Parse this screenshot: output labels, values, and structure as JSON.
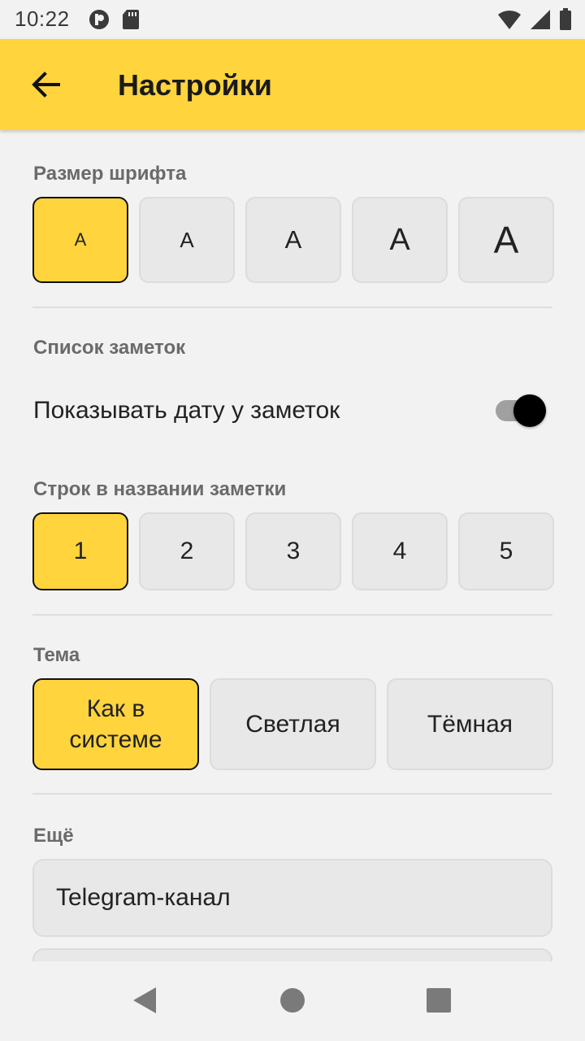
{
  "status_bar": {
    "time": "10:22",
    "left_icons": [
      "app-notification-icon",
      "sd-card-icon"
    ],
    "right_icons": [
      "wifi-icon",
      "cellular-icon",
      "battery-icon"
    ]
  },
  "app_bar": {
    "title": "Настройки",
    "background": "#ffd43d"
  },
  "font_size": {
    "label": "Размер шрифта",
    "options": [
      "A",
      "A",
      "A",
      "A",
      "A"
    ],
    "selected_index": 0
  },
  "notes_list": {
    "label": "Список заметок",
    "show_date_label": "Показывать дату у заметок",
    "show_date_enabled": true
  },
  "title_lines": {
    "label": "Строк в названии заметки",
    "options": [
      "1",
      "2",
      "3",
      "4",
      "5"
    ],
    "selected_index": 0
  },
  "theme": {
    "label": "Тема",
    "options": [
      "Как в системе",
      "Светлая",
      "Тёмная"
    ],
    "selected_index": 0
  },
  "more": {
    "label": "Ещё",
    "items": [
      "Telegram-канал",
      ""
    ]
  },
  "colors": {
    "accent": "#ffd43d",
    "tile_bg": "#e8e8e8",
    "selected_border": "#111111"
  }
}
